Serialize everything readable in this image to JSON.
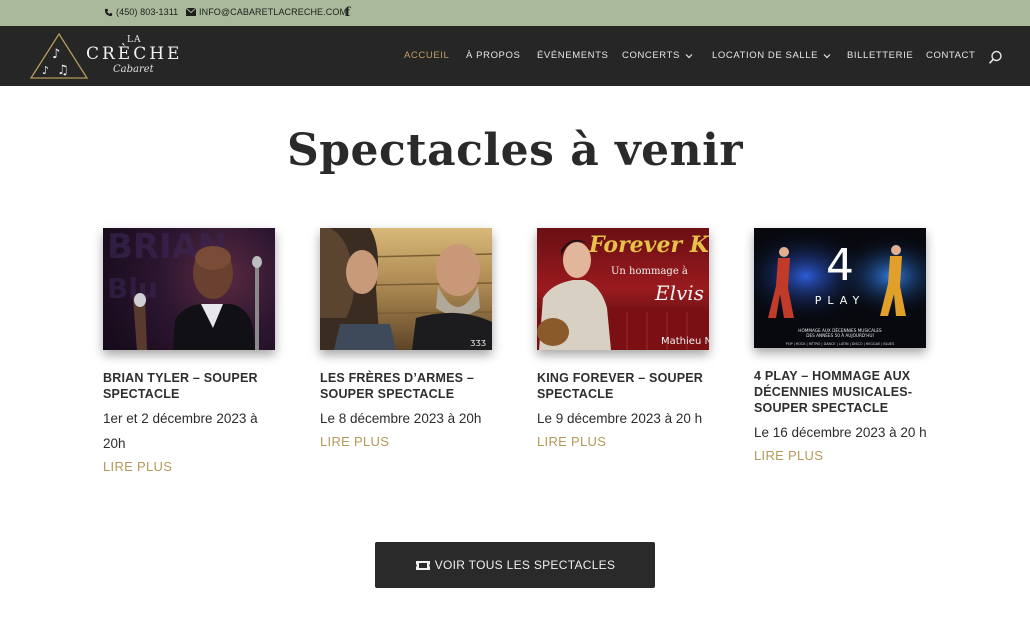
{
  "topbar": {
    "phone": "(450) 803-1311",
    "email": "INFO@CABARETLACRECHE.COM",
    "facebook_glyph": "f"
  },
  "logo": {
    "la": "LA",
    "name": "CRÈCHE",
    "sub": "Cabaret"
  },
  "nav": {
    "items": [
      {
        "label": "ACCUEIL",
        "active": true,
        "dropdown": false
      },
      {
        "label": "À PROPOS",
        "active": false,
        "dropdown": false
      },
      {
        "label": "ÉVÉNEMENTS",
        "active": false,
        "dropdown": false
      },
      {
        "label": "CONCERTS",
        "active": false,
        "dropdown": true
      },
      {
        "label": "LOCATION DE SALLE",
        "active": false,
        "dropdown": true
      },
      {
        "label": "BILLETTERIE",
        "active": false,
        "dropdown": false
      },
      {
        "label": "CONTACT",
        "active": false,
        "dropdown": false
      }
    ],
    "search_icon": "search-icon",
    "active_color": "#bfa062"
  },
  "main": {
    "title": "Spectacles à venir",
    "cards": [
      {
        "title": "BRIAN TYLER – SOUPER SPECTACLE",
        "date": "1er et 2 décembre 2023 à 20h",
        "more": "LIRE PLUS"
      },
      {
        "title": "LES FRÈRES D’ARMES – SOUPER SPECTACLE",
        "date": "Le 8 décembre 2023 à 20h",
        "more": "LIRE PLUS"
      },
      {
        "title": "KING FOREVER – SOUPER SPECTACLE",
        "date": "Le 9 décembre 2023 à 20 h",
        "more": "LIRE PLUS",
        "image_text": {
          "line1": "Forever Ki",
          "line2": "Un hommage à",
          "line3": "Elvis",
          "line4": "Mathieu Na"
        }
      },
      {
        "title": "4 PLAY – HOMMAGE AUX DÉCENNIES MUSICALES- SOUPER SPECTACLE",
        "date": "Le 16 décembre 2023 à 20 h",
        "more": "LIRE PLUS",
        "image_text": {
          "big": "4",
          "play": "PLAY",
          "line1": "HOMMAGE AUX DÉCENNIES MUSICALES",
          "line2": "DES ANNÉES 50 À AUJOURD'HUI",
          "genres": "POP | ROCK | RÉTRO | DANCE | LATIN | DISCO | REGGAE | BLUES"
        }
      }
    ],
    "cta": {
      "label": "VOIR TOUS LES SPECTACLES",
      "icon": "ticket-icon"
    }
  },
  "colors": {
    "topbar_bg": "#a9b99a",
    "header_bg": "#262626",
    "accent": "#b49a5a",
    "button_bg": "#2a2a2a"
  }
}
